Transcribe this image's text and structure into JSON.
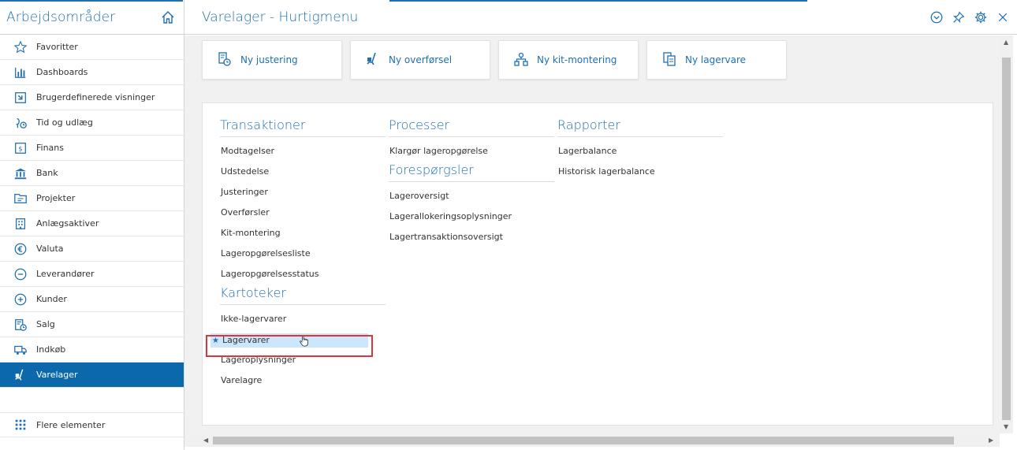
{
  "sidebar": {
    "title": "Arbejdsområder",
    "items": [
      {
        "label": "Favoritter",
        "icon": "star-icon"
      },
      {
        "label": "Dashboards",
        "icon": "bar-chart-icon"
      },
      {
        "label": "Brugerdefinerede visninger",
        "icon": "custom-view-icon"
      },
      {
        "label": "Tid og udlæg",
        "icon": "time-expense-icon"
      },
      {
        "label": "Finans",
        "icon": "finance-icon"
      },
      {
        "label": "Bank",
        "icon": "bank-icon"
      },
      {
        "label": "Projekter",
        "icon": "projects-icon"
      },
      {
        "label": "Anlægsaktiver",
        "icon": "fixed-assets-icon"
      },
      {
        "label": "Valuta",
        "icon": "euro-icon"
      },
      {
        "label": "Leverandører",
        "icon": "minus-circle-icon"
      },
      {
        "label": "Kunder",
        "icon": "plus-circle-icon"
      },
      {
        "label": "Salg",
        "icon": "sales-icon"
      },
      {
        "label": "Indkøb",
        "icon": "purchase-truck-icon"
      },
      {
        "label": "Varelager",
        "icon": "inventory-icon",
        "active": true
      }
    ],
    "more_label": "Flere elementer"
  },
  "header": {
    "title": "Varelager - Hurtigmenu"
  },
  "tiles": [
    {
      "label": "Ny justering",
      "icon": "adjustment-icon"
    },
    {
      "label": "Ny overførsel",
      "icon": "transfer-icon"
    },
    {
      "label": "Ny kit-montering",
      "icon": "kit-assembly-icon"
    },
    {
      "label": "Ny lagervare",
      "icon": "stock-item-icon"
    }
  ],
  "sections": {
    "transaktioner": {
      "title": "Transaktioner",
      "links": [
        "Modtagelser",
        "Udstedelse",
        "Justeringer",
        "Overførsler",
        "Kit-montering",
        "Lageropgørelsesliste",
        "Lageropgørelsesstatus"
      ]
    },
    "kartoteker": {
      "title": "Kartoteker",
      "links": [
        "Ikke-lagervarer",
        "Lagervarer",
        "Lageroplysninger",
        "Varelagre"
      ]
    },
    "processer": {
      "title": "Processer",
      "links": [
        "Klargør lageropgørelse"
      ]
    },
    "forespoergsler": {
      "title": "Forespørgsler",
      "links": [
        "Lageroversigt",
        "Lagerallokeringsoplysninger",
        "Lagertransaktionsoversigt"
      ]
    },
    "rapporter": {
      "title": "Rapporter",
      "links": [
        "Lagerbalance",
        "Historisk lagerbalance"
      ]
    }
  },
  "colors": {
    "accent": "#1f6fb2",
    "active_bg": "#0b69ab",
    "selection_bg": "#cce6fb",
    "highlight_border": "#d9363e"
  }
}
